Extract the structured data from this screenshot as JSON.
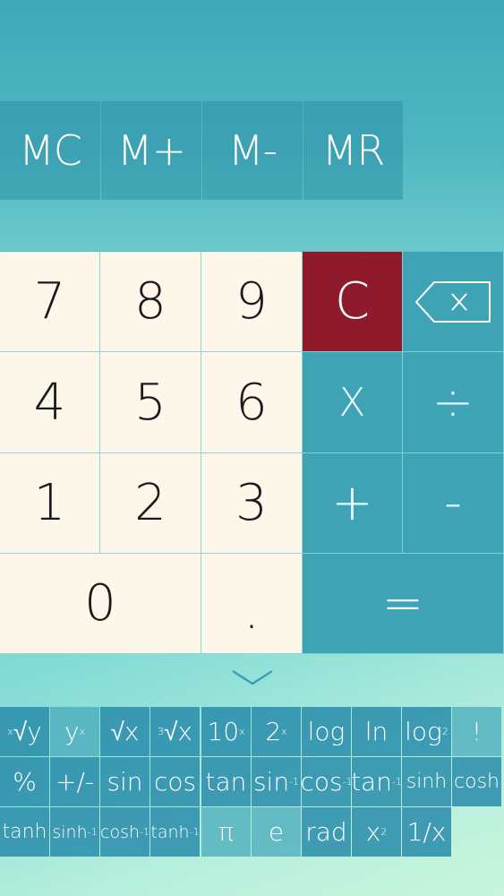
{
  "memory": [
    "MC",
    "M+",
    "M-",
    "MR"
  ],
  "keys": {
    "seven": "7",
    "eight": "8",
    "nine": "9",
    "four": "4",
    "five": "5",
    "six": "6",
    "one": "1",
    "two": "2",
    "three": "3",
    "zero": "0",
    "dot": ".",
    "clear": "C",
    "multiply": "X",
    "divide": "÷",
    "plus": "+",
    "minus": "-",
    "equals": "="
  },
  "sci_row1": [
    "√y",
    "y",
    "√x",
    "√x",
    "10",
    "2",
    "log",
    "ln",
    "log",
    "!"
  ],
  "sci_row1_sups": [
    "x",
    "x",
    "",
    "3",
    "x",
    "x",
    "",
    "",
    "2",
    ""
  ],
  "sci_row2": [
    "%",
    "+/-",
    "sin",
    "cos",
    "tan",
    "sin",
    "cos",
    "tan",
    "sinh",
    "cosh"
  ],
  "sci_row2_sups": [
    "",
    "",
    "",
    "",
    "",
    "-1",
    "-1",
    "-1",
    "",
    ""
  ],
  "sci_row3": [
    "tanh",
    "sinh",
    "cosh",
    "tanh",
    "π",
    "e",
    "rad",
    "x",
    "1/x"
  ],
  "sci_row3_sups": [
    "",
    "-1",
    "-1",
    "-1",
    "",
    "",
    "",
    "2",
    ""
  ],
  "colors": {
    "clear_red": "#8e1a2c",
    "operator_teal": "#3ea3b5",
    "number_cream": "#fdf7ea"
  },
  "icons": {
    "backspace": "backspace-icon",
    "collapse": "chevron-down-icon"
  }
}
